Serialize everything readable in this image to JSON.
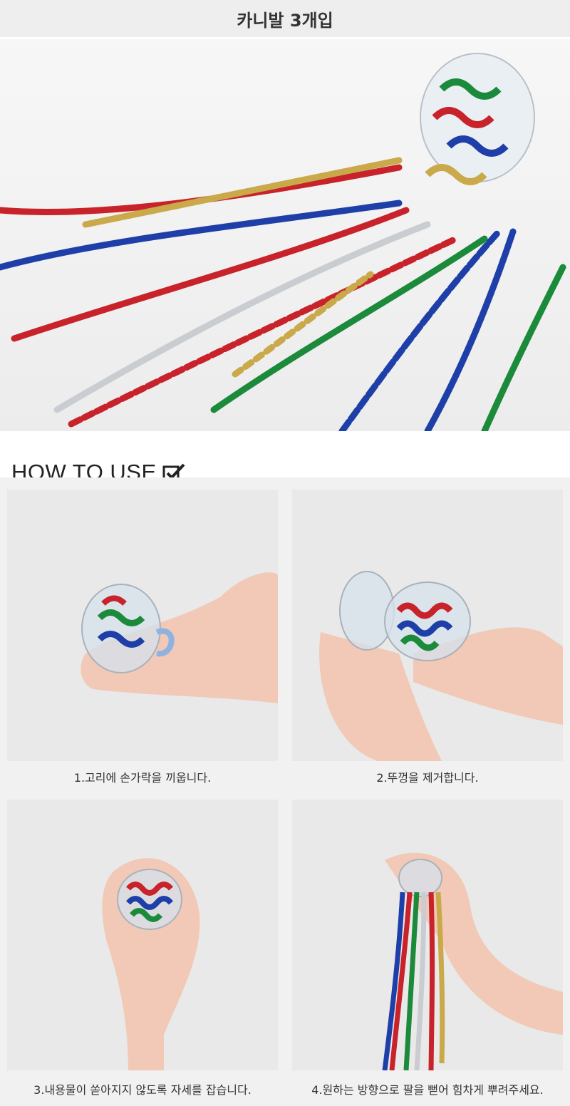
{
  "header": {
    "title": "카니발 3개입"
  },
  "howto": {
    "label": "HOW TO USE",
    "icon": "checkbox-check-icon"
  },
  "steps": [
    {
      "caption": "1.고리에 손가락을 끼웁니다."
    },
    {
      "caption": "2.뚜껑을 제거합니다."
    },
    {
      "caption": "3.내용물이 쏟아지지 않도록 자세를 잡습니다."
    },
    {
      "caption": "4.원하는 방향으로 팔을 뻗어 힘차게 뿌려주세요."
    }
  ],
  "colors": {
    "red": "#c8222a",
    "gold": "#c9a94a",
    "blue": "#1f3fa8",
    "green": "#1b8a3b",
    "silver": "#c9ccd1"
  }
}
